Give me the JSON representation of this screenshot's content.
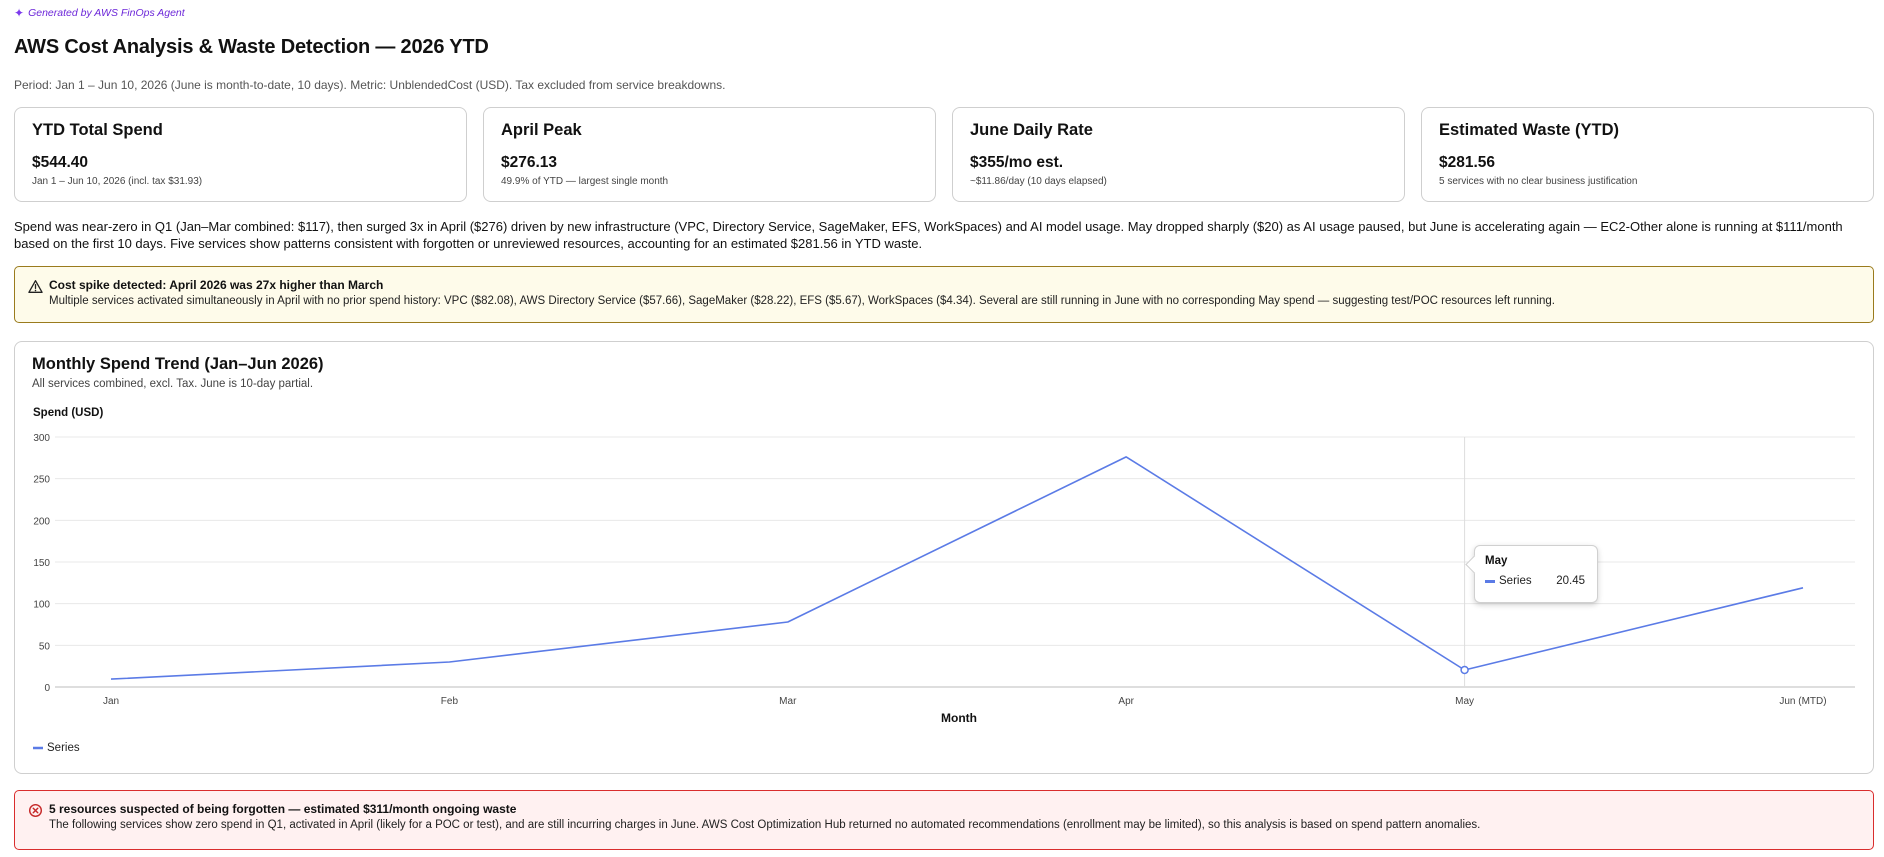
{
  "generated_label": "Generated by AWS FinOps Agent",
  "page_title": "AWS Cost Analysis & Waste Detection — 2026 YTD",
  "period": "Period: Jan 1 – Jun 10, 2026 (June is month-to-date, 10 days). Metric: UnblendedCost (USD). Tax excluded from service breakdowns.",
  "kpis": [
    {
      "title": "YTD Total Spend",
      "value": "$544.40",
      "sub": "Jan 1 – Jun 10, 2026 (incl. tax $31.93)"
    },
    {
      "title": "April Peak",
      "value": "$276.13",
      "sub": "49.9% of YTD — largest single month"
    },
    {
      "title": "June Daily Rate",
      "value": "$355/mo est.",
      "sub": "~$11.86/day (10 days elapsed)"
    },
    {
      "title": "Estimated Waste (YTD)",
      "value": "$281.56",
      "sub": "5 services with no clear business justification"
    }
  ],
  "summary": "Spend was near-zero in Q1 (Jan–Mar combined: $117), then surged 3x in April ($276) driven by new infrastructure (VPC, Directory Service, SageMaker, EFS, WorkSpaces) and AI model usage. May dropped sharply ($20) as AI usage paused, but June is accelerating again — EC2-Other alone is running at $111/month based on the first 10 days. Five services show patterns consistent with forgotten or unreviewed resources, accounting for an estimated $281.56 in YTD waste.",
  "warning": {
    "icon": "warning-triangle-icon",
    "title": "Cost spike detected: April 2026 was 27x higher than March",
    "body": "Multiple services activated simultaneously in April with no prior spend history: VPC ($82.08), AWS Directory Service ($57.66), SageMaker ($28.22), EFS ($5.67), WorkSpaces ($4.34). Several are still running in June with no corresponding May spend — suggesting test/POC resources left running."
  },
  "chart": {
    "title": "Monthly Spend Trend (Jan–Jun 2026)",
    "subtitle": "All services combined, excl. Tax. June is 10-day partial.",
    "tooltip": {
      "category": "May",
      "series": "Series",
      "value": "20.45"
    }
  },
  "chart_data": {
    "type": "line",
    "categories": [
      "Jan",
      "Feb",
      "Mar",
      "Apr",
      "May",
      "Jun (MTD)"
    ],
    "series": [
      {
        "name": "Series",
        "values": [
          9.5,
          30,
          78,
          276.13,
          20.45,
          119
        ],
        "color": "#5b7be6"
      }
    ],
    "xlabel": "Month",
    "ylabel": "Spend (USD)",
    "ylim": [
      0,
      300
    ],
    "yticks": [
      0,
      50,
      100,
      150,
      200,
      250,
      300
    ],
    "grid": true,
    "legend": "bottom-left",
    "highlighted": "May"
  },
  "error": {
    "icon": "error-circle-icon",
    "title": "5 resources suspected of being forgotten — estimated $311/month ongoing waste",
    "body": "The following services show zero spend in Q1, activated in April (likely for a POC or test), and are still incurring charges in June. AWS Cost Optimization Hub returned no automated recommendations (enrollment may be limited), so this analysis is based on spend pattern anomalies."
  }
}
